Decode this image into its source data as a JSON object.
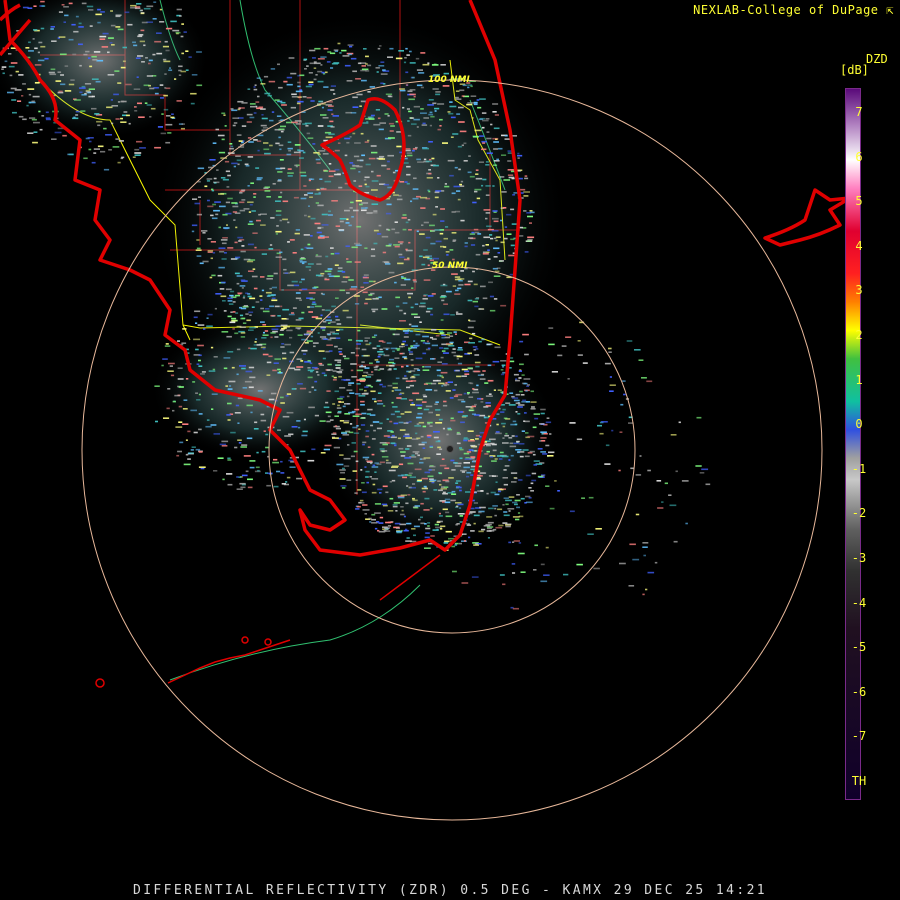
{
  "header": {
    "credit": "NEXLAB-College of DuPage"
  },
  "legend": {
    "product": "DZD",
    "unit": "[dB]",
    "ticks": [
      "7",
      "6",
      "5",
      "4",
      "3",
      "2",
      "1",
      "0",
      "-1",
      "-2",
      "-3",
      "-4",
      "-5",
      "-6",
      "-7",
      "TH"
    ],
    "colors": {
      "top": "#5a0a7a",
      "mid_upper": "#ff2020",
      "mid": "#10c0a0",
      "zero": "#3050e0",
      "neg": "#c8c8c8",
      "bottom": "#10002a"
    }
  },
  "range_rings": [
    {
      "label": "50 NMI"
    },
    {
      "label": "100 NMI"
    }
  ],
  "radar": {
    "site": "KAMX"
  },
  "footer": {
    "caption": "DIFFERENTIAL REFLECTIVITY (ZDR) 0.5 DEG - KAMX 29 DEC 25 14:21"
  },
  "colors": {
    "background": "#000000",
    "coastline": "#e00000",
    "county_lines": "#c01010",
    "state_highway": "#ffff00",
    "range_ring": "#e8b89a",
    "label": "#ffff33"
  }
}
